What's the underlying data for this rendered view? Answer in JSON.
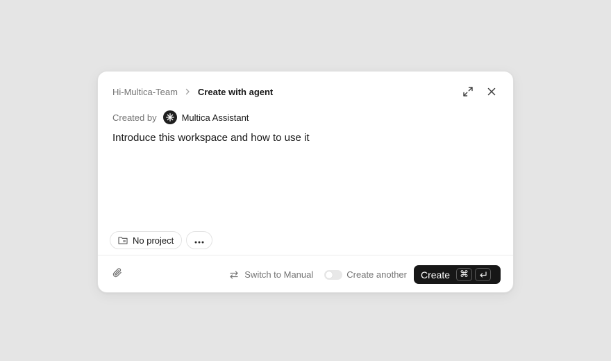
{
  "dialog": {
    "breadcrumb": {
      "workspace": "Hi-Multica-Team",
      "current": "Create with agent"
    },
    "actions": {
      "expand_icon": "expand-icon",
      "close_icon": "close-icon"
    },
    "creator": {
      "label": "Created by",
      "name": "Multica Assistant",
      "avatar_icon": "asterisk-icon"
    },
    "prompt": "Introduce this workspace and how to use it",
    "chips": {
      "project": "No project",
      "more_icon": "more-horizontal-icon"
    },
    "footer": {
      "attach_icon": "paperclip-icon",
      "switch_label": "Switch to Manual",
      "create_another_label": "Create another",
      "create_another_on": false,
      "create_label": "Create",
      "shortcut_cmd": "⌘",
      "shortcut_enter": "↵"
    }
  },
  "colors": {
    "background": "#e5e5e5",
    "primary_button": "#171717",
    "muted_text": "#737373"
  }
}
